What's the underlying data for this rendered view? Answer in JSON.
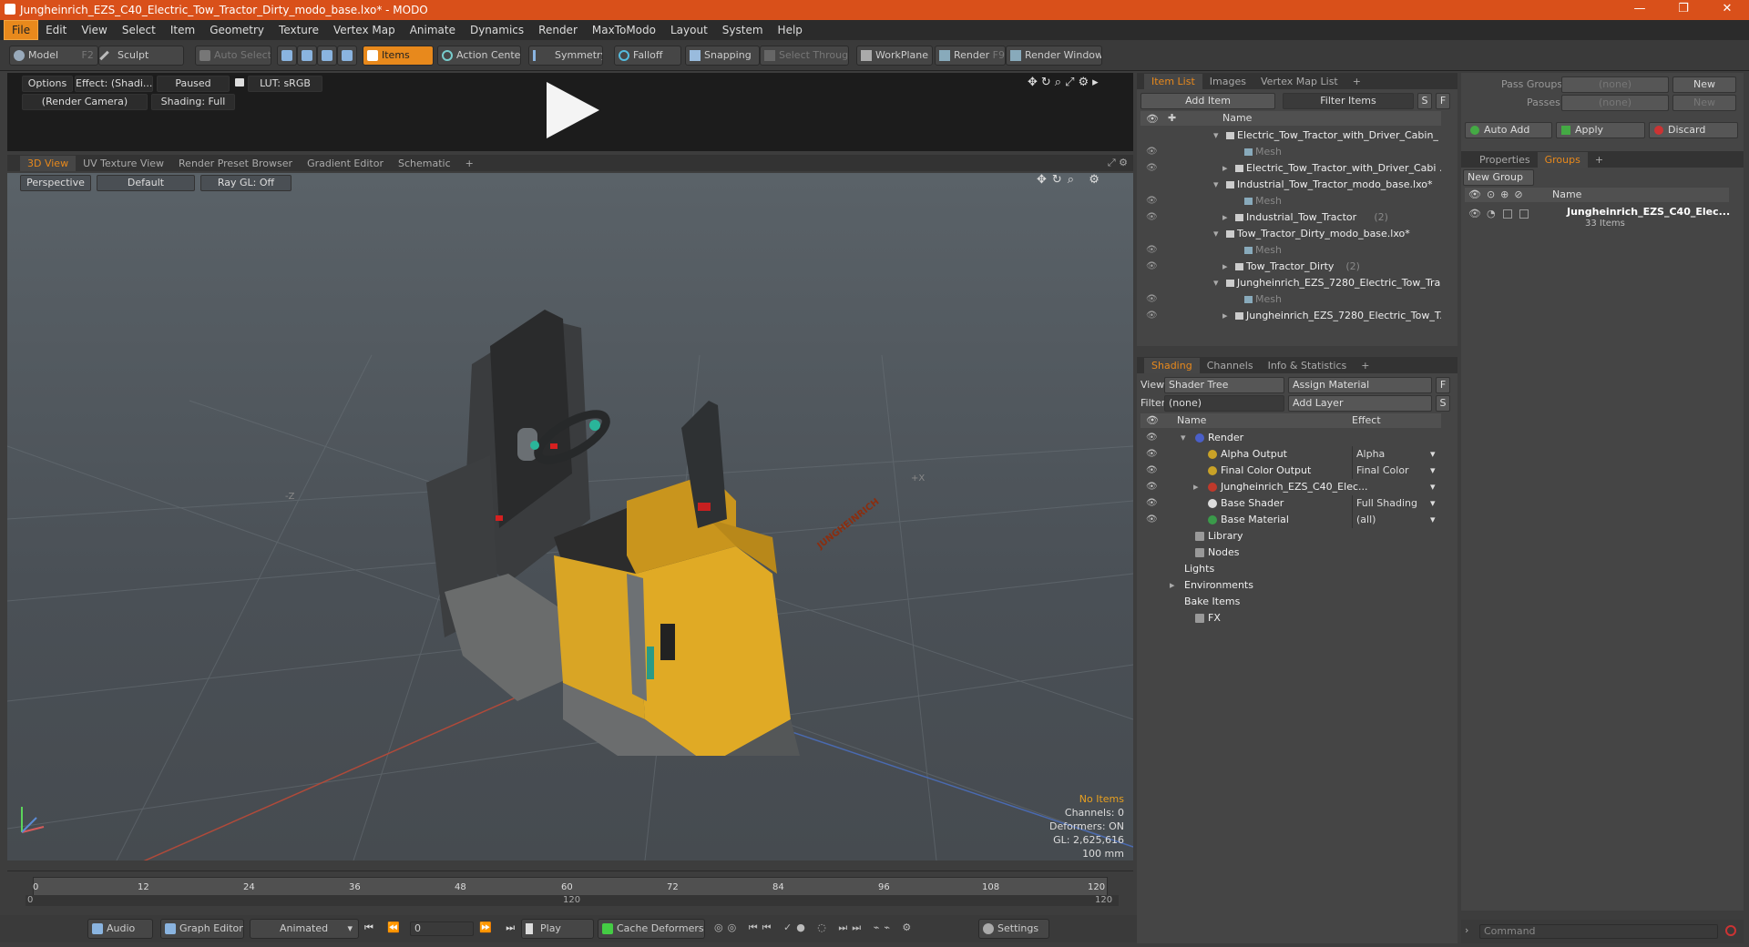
{
  "window": {
    "title": "Jungheinrich_EZS_C40_Electric_Tow_Tractor_Dirty_modo_base.lxo* - MODO",
    "min": "—",
    "max": "❐",
    "close": "✕"
  },
  "menu": [
    "File",
    "Edit",
    "View",
    "Select",
    "Item",
    "Geometry",
    "Texture",
    "Vertex Map",
    "Animate",
    "Dynamics",
    "Render",
    "MaxToModo",
    "Layout",
    "System",
    "Help"
  ],
  "toolbar": {
    "model": "Model",
    "model_key": "F2",
    "sculpt": "Sculpt",
    "auto_select": "Auto Select",
    "items": "Items",
    "action_center": "Action Center",
    "symmetry": "Symmetry",
    "falloff": "Falloff",
    "snapping": "Snapping",
    "select_through": "Select Through",
    "workplane": "WorkPlane",
    "render": "Render",
    "render_key": "F9",
    "render_window": "Render Window"
  },
  "preview": {
    "options": "Options",
    "effect": "Effect: (Shadi...",
    "paused": "Paused",
    "lut": "LUT: sRGB",
    "camera": "(Render Camera)",
    "shading": "Shading: Full"
  },
  "view_tabs": [
    "3D View",
    "UV Texture View",
    "Render Preset Browser",
    "Gradient Editor",
    "Schematic"
  ],
  "viewport": {
    "perspective": "Perspective",
    "default": "Default",
    "raygl": "Ray GL: Off",
    "brand": "JUNGHEINRICH",
    "axis_z": "-Z",
    "axis_x": "+X",
    "hud": {
      "no_items": "No Items",
      "channels": "Channels: 0",
      "deformers": "Deformers: ON",
      "gl": "GL: 2,625,616",
      "scale": "100 mm"
    }
  },
  "timeline": {
    "ticks": [
      "0",
      "12",
      "24",
      "36",
      "48",
      "60",
      "72",
      "84",
      "96",
      "108",
      "120"
    ],
    "end_left": "0",
    "mid": "120",
    "end_right": "120"
  },
  "bottom": {
    "audio": "Audio",
    "graph_editor": "Graph Editor",
    "animated": "Animated",
    "frame": "0",
    "play": "Play",
    "cache": "Cache Deformers",
    "settings": "Settings"
  },
  "item_list": {
    "tabs": [
      "Item List",
      "Images",
      "Vertex Map List"
    ],
    "add_item": "Add Item",
    "filter": "Filter Items",
    "s": "S",
    "f": "F",
    "col_name": "Name",
    "rows": [
      {
        "label": "Electric_Tow_Tractor_with_Driver_Cabin_ ...",
        "indent": 0,
        "type": "scene"
      },
      {
        "label": "Mesh",
        "indent": 2,
        "type": "mesh"
      },
      {
        "label": "Electric_Tow_Tractor_with_Driver_Cabi ...",
        "indent": 1,
        "type": "item"
      },
      {
        "label": "Industrial_Tow_Tractor_modo_base.lxo*",
        "indent": 0,
        "type": "scene"
      },
      {
        "label": "Mesh",
        "indent": 2,
        "type": "mesh"
      },
      {
        "label": "Industrial_Tow_Tractor",
        "count": "(2)",
        "indent": 1,
        "type": "item"
      },
      {
        "label": "Tow_Tractor_Dirty_modo_base.lxo*",
        "indent": 0,
        "type": "scene"
      },
      {
        "label": "Mesh",
        "indent": 2,
        "type": "mesh"
      },
      {
        "label": "Tow_Tractor_Dirty",
        "count": "(2)",
        "indent": 1,
        "type": "item"
      },
      {
        "label": "Jungheinrich_EZS_7280_Electric_Tow_Tra ...",
        "indent": 0,
        "type": "scene"
      },
      {
        "label": "Mesh",
        "indent": 2,
        "type": "mesh"
      },
      {
        "label": "Jungheinrich_EZS_7280_Electric_Tow_T...",
        "indent": 1,
        "type": "item"
      }
    ]
  },
  "shading": {
    "tabs": [
      "Shading",
      "Channels",
      "Info & Statistics"
    ],
    "view_label": "View",
    "view_value": "Shader Tree",
    "assign": "Assign Material",
    "f": "F",
    "filter_label": "Filter",
    "filter_value": "(none)",
    "add_layer": "Add Layer",
    "s": "S",
    "col_name": "Name",
    "col_effect": "Effect",
    "rows": [
      {
        "label": "Render",
        "effect": "",
        "indent": 0,
        "color": "#4a5fc8"
      },
      {
        "label": "Alpha Output",
        "effect": "Alpha",
        "indent": 1,
        "color": "#c9a227"
      },
      {
        "label": "Final Color Output",
        "effect": "Final Color",
        "indent": 1,
        "color": "#c9a227"
      },
      {
        "label": "Jungheinrich_EZS_C40_Elec...",
        "effect": "",
        "indent": 1,
        "color": "#c0392b"
      },
      {
        "label": "Base Shader",
        "effect": "Full Shading",
        "indent": 1,
        "color": "#dddddd"
      },
      {
        "label": "Base Material",
        "effect": "(all)",
        "indent": 1,
        "color": "#3a9a4a"
      },
      {
        "label": "Library",
        "effect": "",
        "indent": 0,
        "color": ""
      },
      {
        "label": "Nodes",
        "effect": "",
        "indent": 0,
        "color": ""
      },
      {
        "label": "Lights",
        "effect": "",
        "indent": -1,
        "color": ""
      },
      {
        "label": "Environments",
        "effect": "",
        "indent": -1,
        "color": ""
      },
      {
        "label": "Bake Items",
        "effect": "",
        "indent": -1,
        "color": ""
      },
      {
        "label": "FX",
        "effect": "",
        "indent": 0,
        "color": ""
      }
    ]
  },
  "right": {
    "pass_groups": "Pass Groups",
    "passes": "Passes",
    "none": "(none)",
    "new": "New",
    "auto_add": "Auto Add",
    "apply": "Apply",
    "discard": "Discard",
    "tabs": [
      "Properties",
      "Groups"
    ],
    "new_group": "New Group",
    "col_name": "Name",
    "group_name": "Jungheinrich_EZS_C40_Elec...",
    "group_count": "33 Items",
    "command": "Command"
  }
}
